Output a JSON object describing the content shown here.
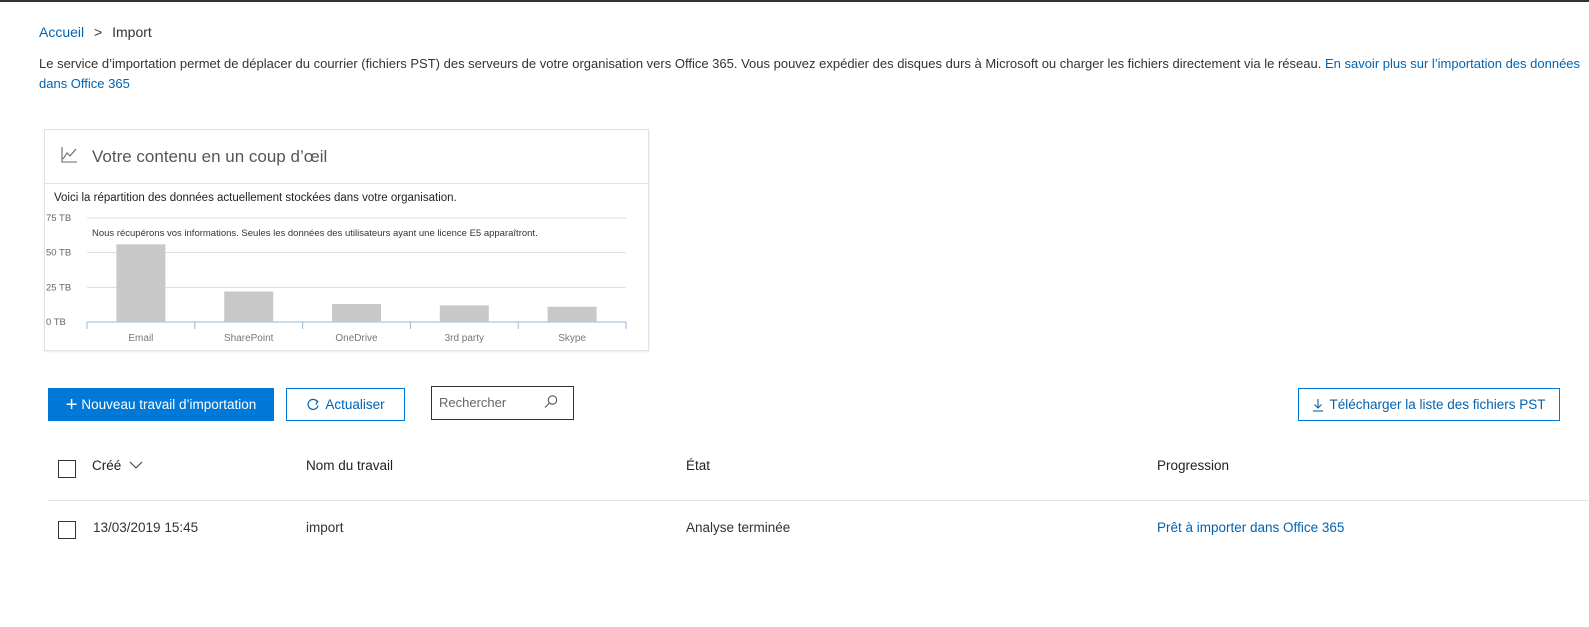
{
  "breadcrumb": {
    "home": "Accueil",
    "separator": ">",
    "current": "Import"
  },
  "description": {
    "text": "Le service d’importation permet de déplacer du courrier (fichiers PST) des serveurs de votre organisation vers Office 365. Vous pouvez expédier des disques durs à Microsoft ou charger les fichiers directement via le réseau.",
    "link": "En savoir plus sur l’importation des données dans Office 365"
  },
  "card": {
    "title": "Votre contenu en un coup d’œil",
    "subtitle": "Voici la répartition des données actuellement stockées dans votre organisation.",
    "icon": "line-chart-icon"
  },
  "chart_data": {
    "type": "bar",
    "categories": [
      "Email",
      "SharePoint",
      "OneDrive",
      "3rd party",
      "Skype"
    ],
    "values": [
      56,
      22,
      13,
      12,
      11
    ],
    "ylim": [
      0,
      75
    ],
    "yticks": [
      0,
      25,
      50,
      75
    ],
    "ytick_labels": [
      "0 TB",
      "25 TB",
      "50 TB",
      "75 TB"
    ],
    "annotation": "Nous récupérons vos informations. Seules les données des utilisateurs ayant une licence E5 apparaîtront.",
    "bar_color": "#c8c8c8",
    "grid": true
  },
  "toolbar": {
    "new_job": "Nouveau travail d’importation",
    "refresh": "Actualiser",
    "search_placeholder": "Rechercher",
    "download": "Télécharger la liste des fichiers PST"
  },
  "table": {
    "columns": [
      "Créé",
      "Nom du travail",
      "État",
      "Progression"
    ],
    "rows": [
      {
        "created": "13/03/2019 15:45",
        "name": "import",
        "state": "Analyse terminée",
        "progress": "Prêt à importer dans Office 365"
      }
    ]
  },
  "colors": {
    "accent": "#0078d7",
    "link": "#0063b1"
  }
}
